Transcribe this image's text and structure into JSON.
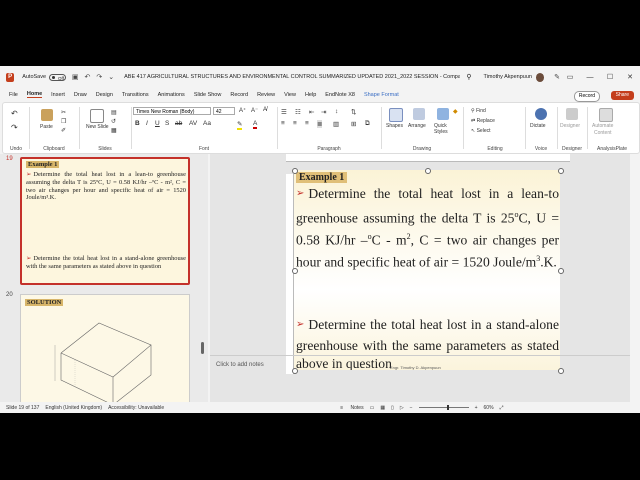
{
  "titlebar": {
    "autosave_label": "AutoSave",
    "autosave_state": "Off",
    "doc_title": "ABE 417 AGRICULTURAL STRUCTURES AND ENVIRONMENTAL CONTROL SUMMARIZED UPDATED 2021_2022 SESSION - Compatibility...",
    "user_name": "Timothy Akpenpuun"
  },
  "menu": [
    "File",
    "Home",
    "Insert",
    "Draw",
    "Design",
    "Transitions",
    "Animations",
    "Slide Show",
    "Record",
    "Review",
    "View",
    "Help",
    "EndNote X8",
    "Shape Format"
  ],
  "menu_active": "Home",
  "record_label": "Record",
  "share_label": "Share",
  "ribbon": {
    "undo": "Undo",
    "paste": "Paste",
    "clipboard": "Clipboard",
    "new_slide": "New Slide",
    "slides": "Slides",
    "font_name": "Times New Roman (Body)",
    "font_size": "42",
    "font": "Font",
    "paragraph": "Paragraph",
    "shapes": "Shapes",
    "arrange": "Arrange",
    "quick_styles": "Quick Styles",
    "drawing": "Drawing",
    "find": "Find",
    "replace": "Replace",
    "select": "Select",
    "editing": "Editing",
    "dictate": "Dictate",
    "voice": "Voice",
    "designer_btn": "Designer",
    "designer": "Designer",
    "automate_1": "Automate",
    "automate_2": "Content",
    "analysis": "AnalysisPlate"
  },
  "thumbnails": [
    {
      "number": "19",
      "heading": "Example 1",
      "p1": "Determine the total heat lost in a lean-to greenhouse assuming the delta T is 25ºC, U = 0.58 KJ/hr –ºC - m², C = two air changes per hour and specific heat of air = 1520 Joule/m³.K.",
      "p2": "Determine the total heat lost in a stand-alone greenhouse with the same parameters as stated above in question"
    },
    {
      "number": "20",
      "heading": "SOLUTION"
    }
  ],
  "slide": {
    "heading": "Example 1",
    "p1_pre": "Determine the total heat lost in a lean-to greenhouse assuming the delta T is 25",
    "p1_sup1": "o",
    "p1_mid": "C, U = 0.58 KJ/hr –",
    "p1_sup2": "o",
    "p1_mid2": "C - m",
    "p1_sup3": "2",
    "p1_mid3": ", C = two air changes per hour and specific heat of air = 1520 Joule/m",
    "p1_sup4": "3",
    "p1_end": ".K.",
    "p2": "Determine the total heat lost in a stand-alone greenhouse with the same parameters as stated above in question",
    "footer": "Engr. Timothy D. Akpenpuun"
  },
  "notes_placeholder": "Click to add notes",
  "status": {
    "slide_pos": "Slide 19 of 137",
    "language": "English (United Kingdom)",
    "accessibility": "Accessibility: Unavailable",
    "notes": "Notes",
    "zoom": "60%"
  }
}
